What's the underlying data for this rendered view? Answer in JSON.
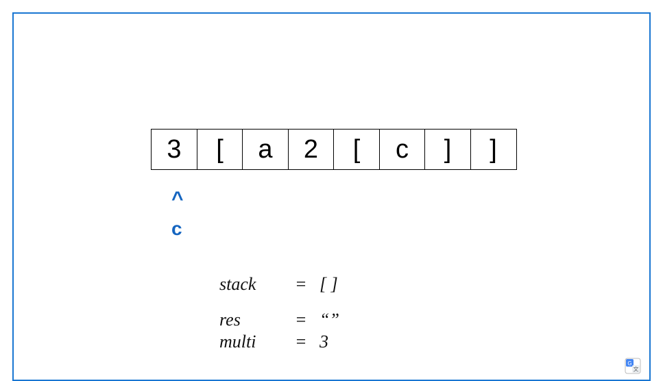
{
  "cells": [
    "3",
    "[",
    "a",
    "2",
    "[",
    "c",
    "]",
    "]"
  ],
  "pointer": {
    "caret": "^",
    "label": "c",
    "index": 0
  },
  "vars": {
    "stack": {
      "name": "stack",
      "eq": "=",
      "value": "[ ]"
    },
    "res": {
      "name": "res",
      "eq": "=",
      "value": "“”"
    },
    "multi": {
      "name": "multi",
      "eq": "=",
      "value": "3"
    }
  },
  "colors": {
    "frame": "#1976d2",
    "pointer": "#1565c0"
  },
  "widget": {
    "name": "google-translate-icon"
  }
}
